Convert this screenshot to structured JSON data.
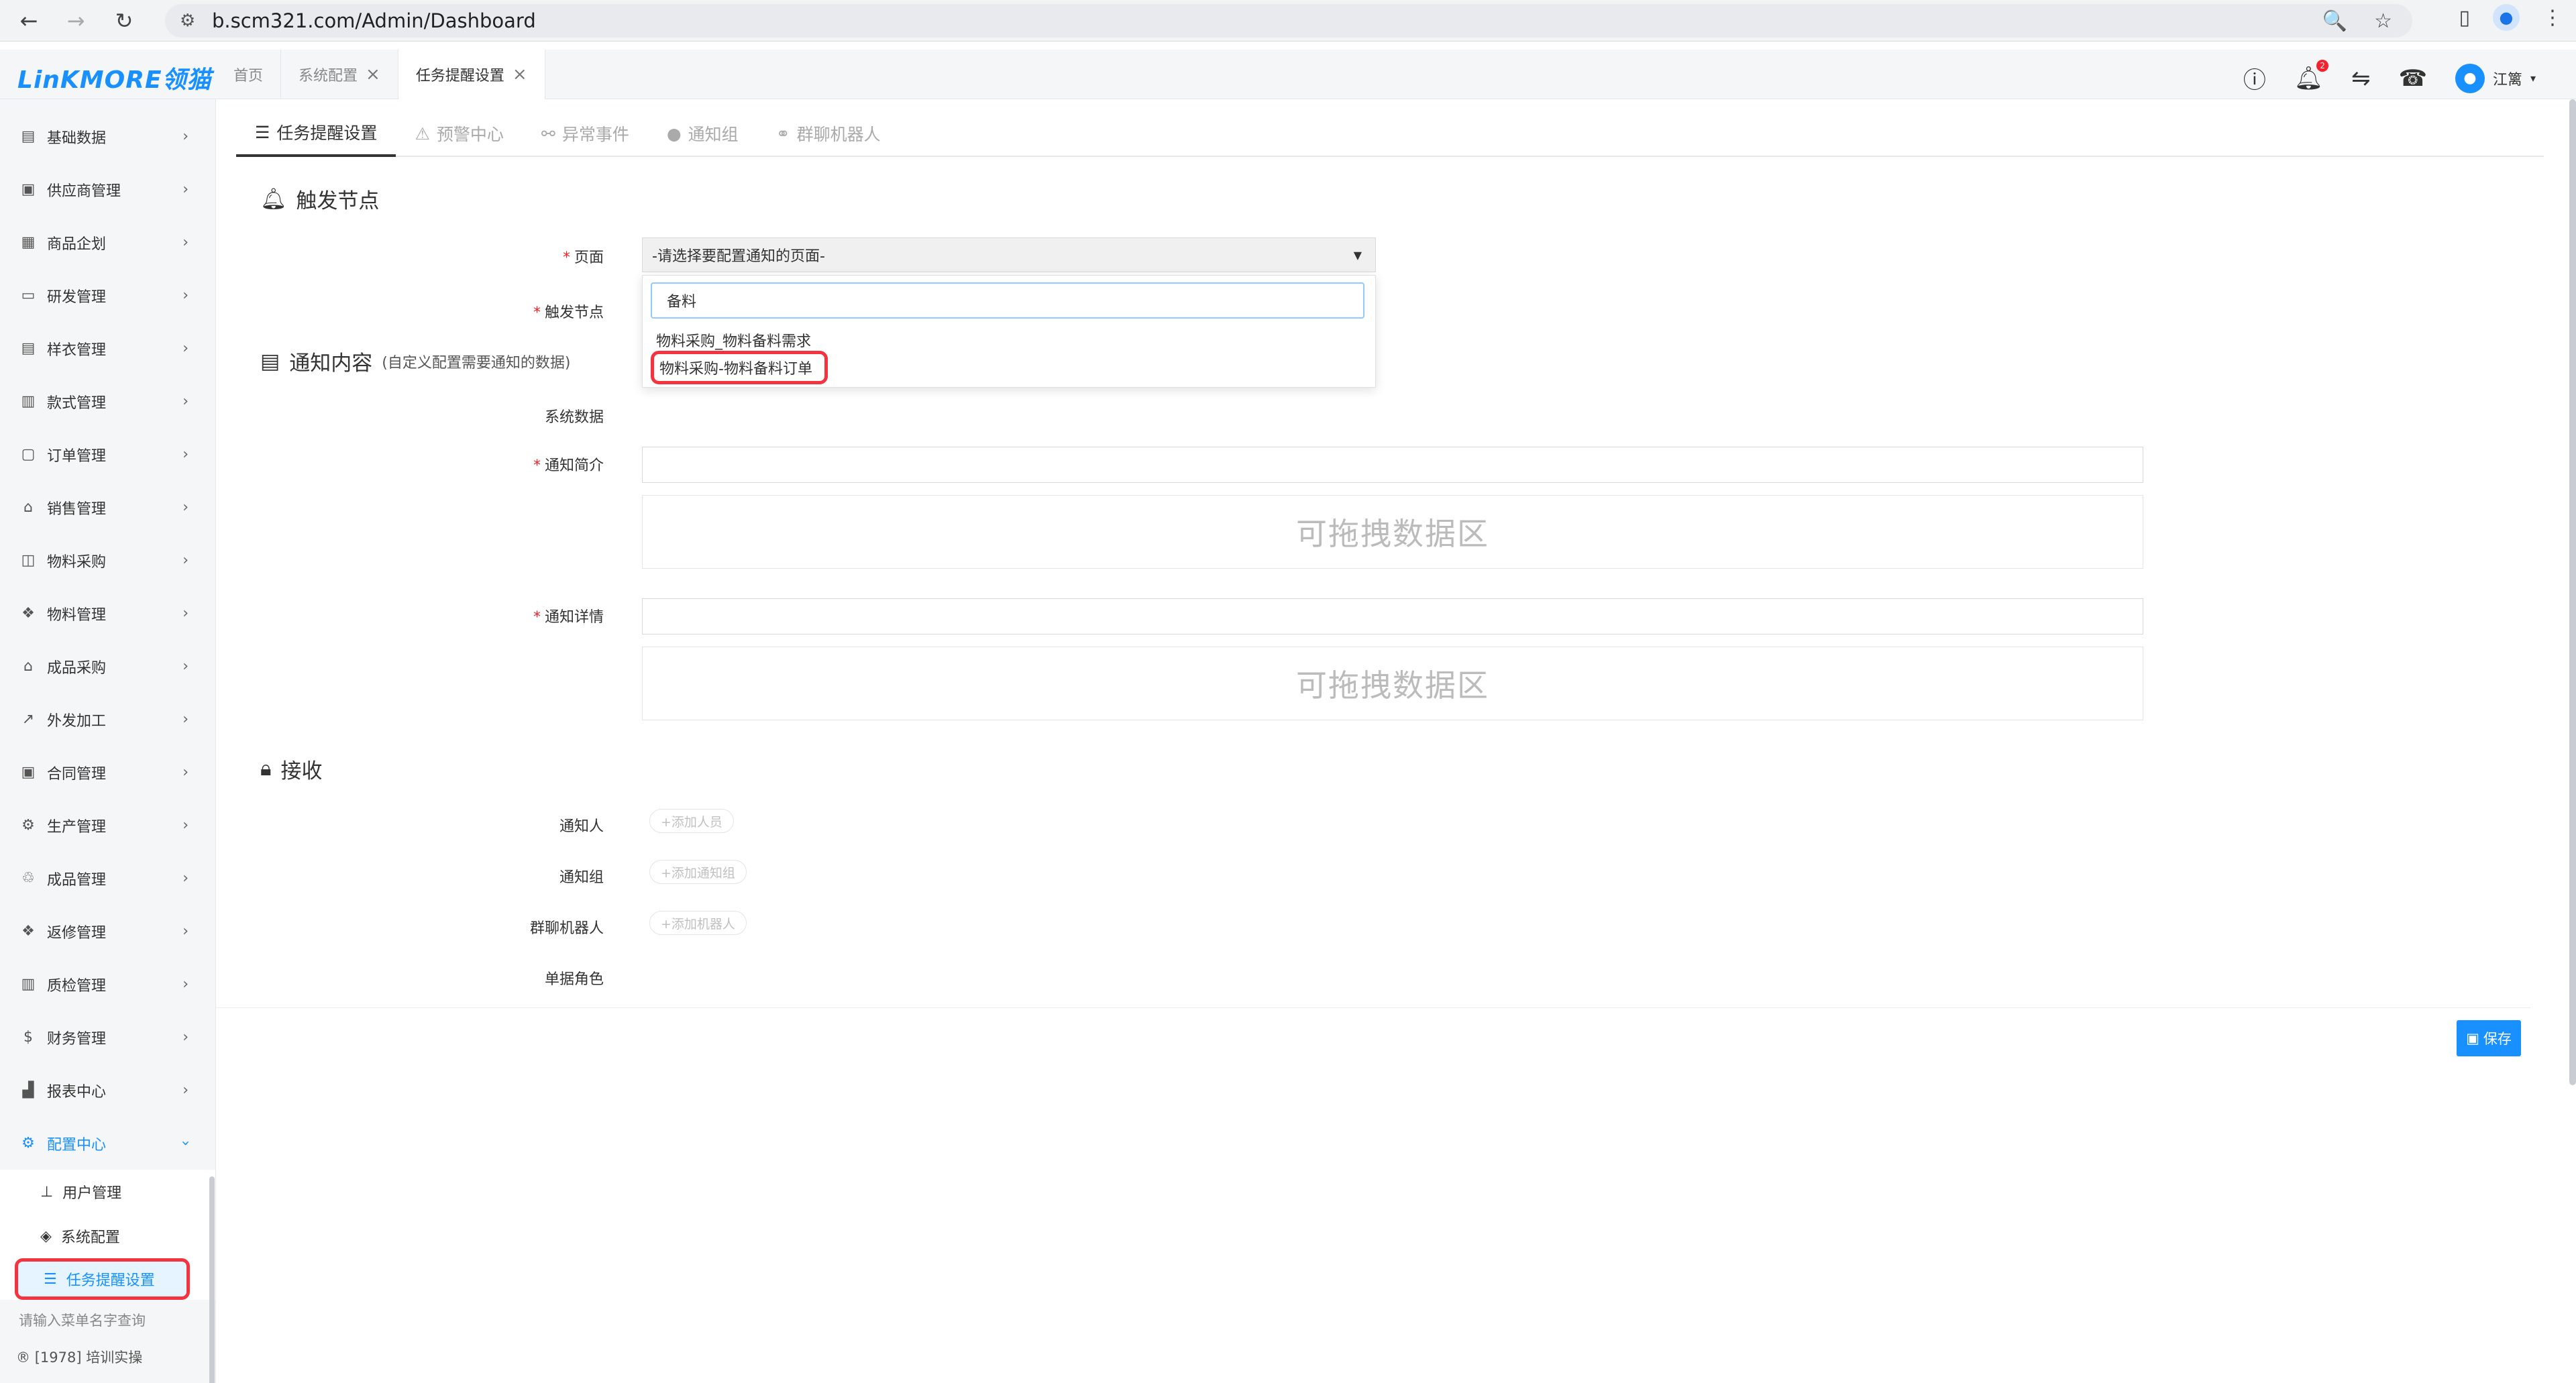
{
  "browser": {
    "url": "b.scm321.com/Admin/Dashboard"
  },
  "app": {
    "logo": "LinKMORE领猫",
    "tabs": [
      {
        "label": "首页"
      },
      {
        "label": "系统配置"
      },
      {
        "label": "任务提醒设置"
      }
    ],
    "user_name": "江篱",
    "notification_badge": "2"
  },
  "sidebar": {
    "items": [
      {
        "label": "基础数据"
      },
      {
        "label": "供应商管理"
      },
      {
        "label": "商品企划"
      },
      {
        "label": "研发管理"
      },
      {
        "label": "样衣管理"
      },
      {
        "label": "款式管理"
      },
      {
        "label": "订单管理"
      },
      {
        "label": "销售管理"
      },
      {
        "label": "物料采购"
      },
      {
        "label": "物料管理"
      },
      {
        "label": "成品采购"
      },
      {
        "label": "外发加工"
      },
      {
        "label": "合同管理"
      },
      {
        "label": "生产管理"
      },
      {
        "label": "成品管理"
      },
      {
        "label": "返修管理"
      },
      {
        "label": "质检管理"
      },
      {
        "label": "财务管理"
      },
      {
        "label": "报表中心"
      },
      {
        "label": "配置中心"
      }
    ],
    "subitems": [
      {
        "label": "用户管理"
      },
      {
        "label": "系统配置"
      },
      {
        "label": "任务提醒设置"
      }
    ],
    "search_placeholder": "请输入菜单名字查询",
    "footer": "[1978] 培训实操"
  },
  "page_tabs": [
    {
      "label": "任务提醒设置"
    },
    {
      "label": "预警中心"
    },
    {
      "label": "异常事件"
    },
    {
      "label": "通知组"
    },
    {
      "label": "群聊机器人"
    }
  ],
  "trigger": {
    "title": "触发节点",
    "page_label": "页面",
    "page_placeholder": "-请选择要配置通知的页面-",
    "node_label": "触发节点",
    "search_value": "备料",
    "options": [
      {
        "label": "物料采购_物料备料需求"
      },
      {
        "label": "物料采购-物料备料订单"
      }
    ]
  },
  "content": {
    "title": "通知内容",
    "subtitle": "(自定义配置需要通知的数据)",
    "system_data_label": "系统数据",
    "summary_label": "通知简介",
    "detail_label": "通知详情",
    "drop_zone_text": "可拖拽数据区"
  },
  "receive": {
    "title": "接收",
    "notify_person_label": "通知人",
    "notify_person_btn": "+添加人员",
    "notify_group_label": "通知组",
    "notify_group_btn": "+添加通知组",
    "robot_label": "群聊机器人",
    "robot_btn": "+添加机器人",
    "doc_role_label": "单据角色"
  },
  "actions": {
    "save": "保存"
  },
  "colors": {
    "accent": "#1890ff",
    "highlight_border": "#f5333f",
    "required": "#f5222d"
  }
}
